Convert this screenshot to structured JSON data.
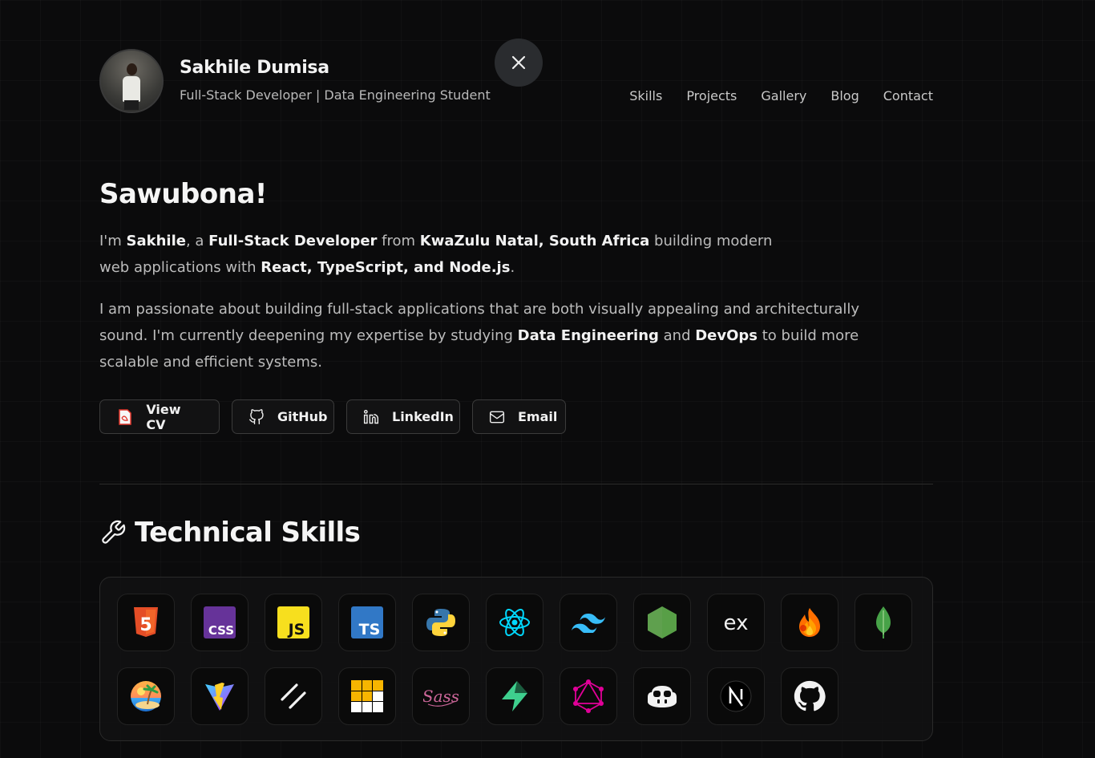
{
  "header": {
    "name": "Sakhile Dumisa",
    "subtitle": "Full-Stack Developer | Data Engineering Student"
  },
  "nav": [
    "Skills",
    "Projects",
    "Gallery",
    "Blog",
    "Contact"
  ],
  "intro": {
    "greeting": "Sawubona!",
    "p1": {
      "a": "I'm ",
      "b": "Sakhile",
      "c": ", a ",
      "d": "Full-Stack Developer",
      "e": " from ",
      "f": "KwaZulu Natal, South Africa",
      "g": " building modern web applications with ",
      "h": "React, TypeScript, and Node.js",
      "i": "."
    },
    "p2": {
      "a": "I am passionate about building full-stack applications that are both visually appealing and architecturally sound. I'm currently deepening my expertise by studying ",
      "b": "Data Engineering",
      "c": " and ",
      "d": "DevOps",
      "e": " to build more scalable and efficient systems."
    }
  },
  "buttons": {
    "cv": "View CV",
    "github": "GitHub",
    "linkedin": "LinkedIn",
    "email": "Email"
  },
  "skills_section": {
    "title": "Technical Skills",
    "icons": [
      "html5-icon",
      "css-icon",
      "javascript-icon",
      "typescript-icon",
      "python-icon",
      "react-icon",
      "tailwind-icon",
      "nodejs-icon",
      "express-icon",
      "firebase-icon",
      "mongodb-icon",
      "beach-emoji-icon",
      "vite-icon",
      "shadcn-icon",
      "tile-grid-icon",
      "sass-icon",
      "supabase-icon",
      "graphql-icon",
      "copilot-icon",
      "nextjs-icon",
      "github-icon"
    ]
  },
  "colors": {
    "background": "#0b0b0c",
    "html5": "#e44d26",
    "css": "#663399",
    "javascript": "#f7df1e",
    "typescript": "#3178c6",
    "react": "#00d8ff",
    "tailwind": "#38bdf8",
    "nodejs": "#5fa04e",
    "mongodb": "#47a248",
    "supabase": "#3ecf8e",
    "graphql": "#e10098",
    "sass": "#cc6699"
  }
}
